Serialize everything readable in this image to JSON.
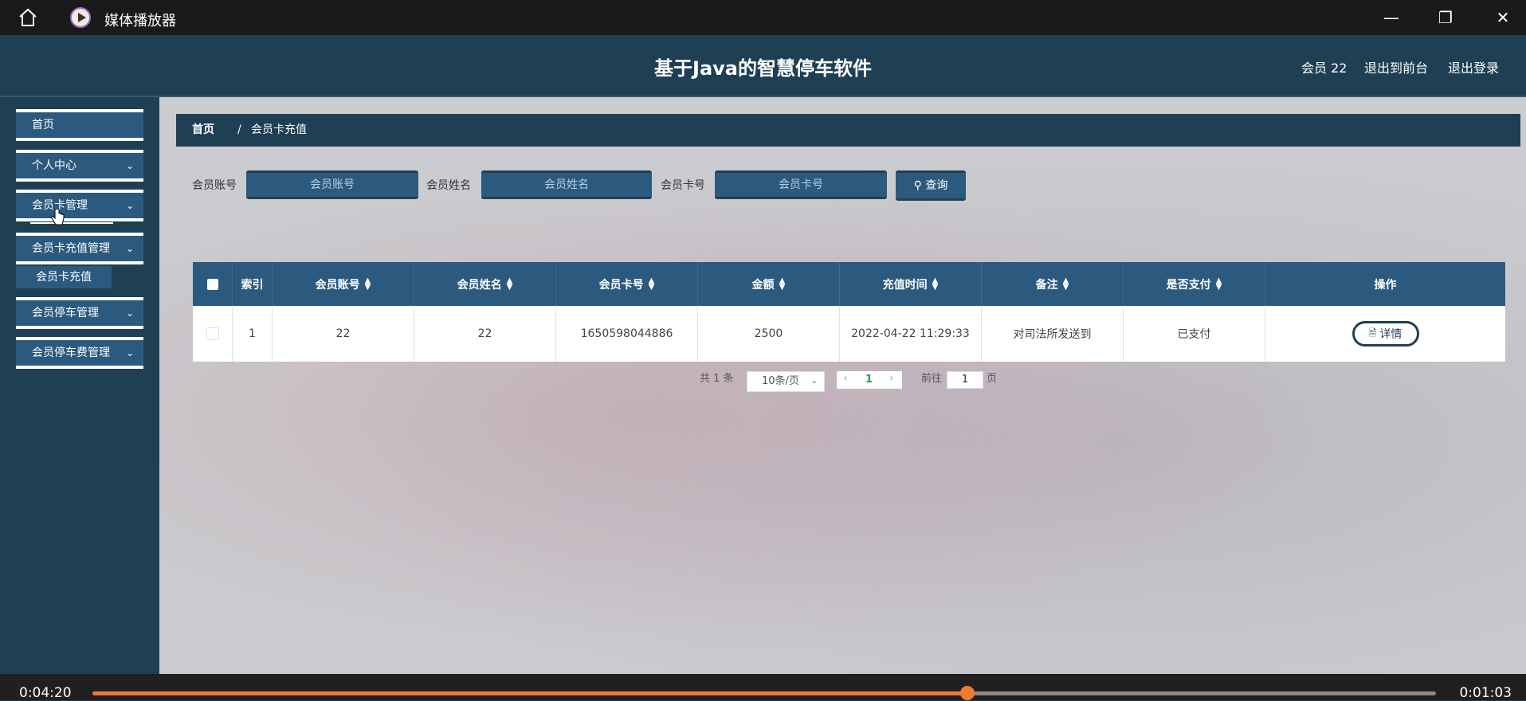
{
  "player": {
    "app_name": "媒体播放器",
    "current_time": "0:04:20",
    "total_time": "0:01:03",
    "progress_fraction": 0.651,
    "accent_color": "#f07a30"
  },
  "header": {
    "title": "基于Java的智慧停车软件",
    "user": "会员 22",
    "front_link": "退出到前台",
    "logout_link": "退出登录"
  },
  "sidebar": {
    "items": [
      {
        "label": "首页"
      },
      {
        "label": "个人中心"
      },
      {
        "label": "会员卡管理"
      },
      {
        "label": "会员卡充值管理"
      },
      {
        "label": "会员停车管理"
      },
      {
        "label": "会员停车费管理"
      }
    ],
    "sub_item": "会员卡充值"
  },
  "breadcrumb": {
    "home": "首页",
    "separator": "/",
    "current": "会员卡充值"
  },
  "search": {
    "account_label": "会员账号",
    "account_placeholder": "会员账号",
    "name_label": "会员姓名",
    "name_placeholder": "会员姓名",
    "card_label": "会员卡号",
    "card_placeholder": "会员卡号",
    "query_label": "查询"
  },
  "table": {
    "headers": [
      "索引",
      "会员账号",
      "会员姓名",
      "会员卡号",
      "金额",
      "充值时间",
      "备注",
      "是否支付",
      "操作"
    ],
    "rows": [
      {
        "index": "1",
        "account": "22",
        "name": "22",
        "card": "1650598044886",
        "amount": "2500",
        "time": "2022-04-22 11:29:33",
        "remark": "对司法所发送到",
        "paid": "已支付",
        "action": "详情"
      }
    ]
  },
  "pagination": {
    "total": "共 1 条",
    "page_size": "10条/页",
    "current_page": "1",
    "goto_label": "前往",
    "goto_value": "1",
    "page_suffix": "页"
  }
}
